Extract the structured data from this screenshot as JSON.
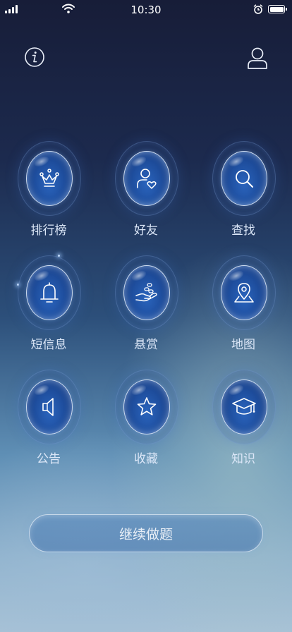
{
  "status_bar": {
    "time": "10:30",
    "icons": [
      "signal-icon",
      "wifi-icon",
      "alarm-icon",
      "battery-icon"
    ]
  },
  "header": {
    "info_icon": "info-icon",
    "user_icon": "user-icon"
  },
  "menu": [
    {
      "label": "排行榜",
      "icon": "crown-icon"
    },
    {
      "label": "好友",
      "icon": "friend-icon"
    },
    {
      "label": "查找",
      "icon": "search-icon"
    },
    {
      "label": "短信息",
      "icon": "bell-icon"
    },
    {
      "label": "悬赏",
      "icon": "reward-icon"
    },
    {
      "label": "地图",
      "icon": "map-pin-icon"
    },
    {
      "label": "公告",
      "icon": "speaker-icon"
    },
    {
      "label": "收藏",
      "icon": "star-icon"
    },
    {
      "label": "知识",
      "icon": "graduation-cap-icon"
    }
  ],
  "continue_button": {
    "label": "继续做题"
  },
  "colors": {
    "orb": "#1f4f9f",
    "label": "#dbe6f7",
    "background_top": "#171d38",
    "background_bottom": "#a8c2d6"
  }
}
